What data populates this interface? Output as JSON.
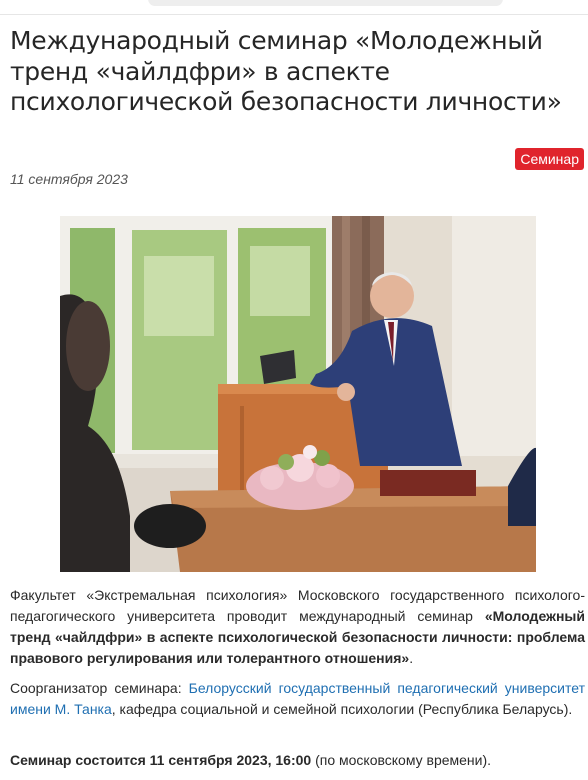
{
  "header": {
    "search_placeholder": ""
  },
  "article": {
    "title": "Международный семинар «Молодежный тренд «чайлдфри» в аспекте психологической безопасности личности»",
    "category": "Семинар",
    "date": "11 сентября 2023",
    "photo_icon": "photo-speaker-at-podium",
    "p1": {
      "text_a": "Факультет «Экстремальная психология» Московского государственного психолого-педагогического университета проводит международный семинар ",
      "bold": "«Молодежный тренд «чайлдфри» в аспекте психологической безопасности личности: проблема правового регулирования или толерантного отношения»",
      "text_b": "."
    },
    "p2": {
      "text_a": "Соорганизатор семинара: ",
      "link": "Белорусский государственный педагогический университет имени М. Танка",
      "text_b": ", кафедра социальной и семейной психологии (Республика Беларусь)."
    },
    "p3": {
      "bold": "Семинар состоится 11 сентября 2023, 16:00",
      "text_b": " (по московскому времени)."
    }
  },
  "colors": {
    "badge": "#e0242c",
    "link": "#1f6fb2",
    "text": "#2a2a2a"
  }
}
